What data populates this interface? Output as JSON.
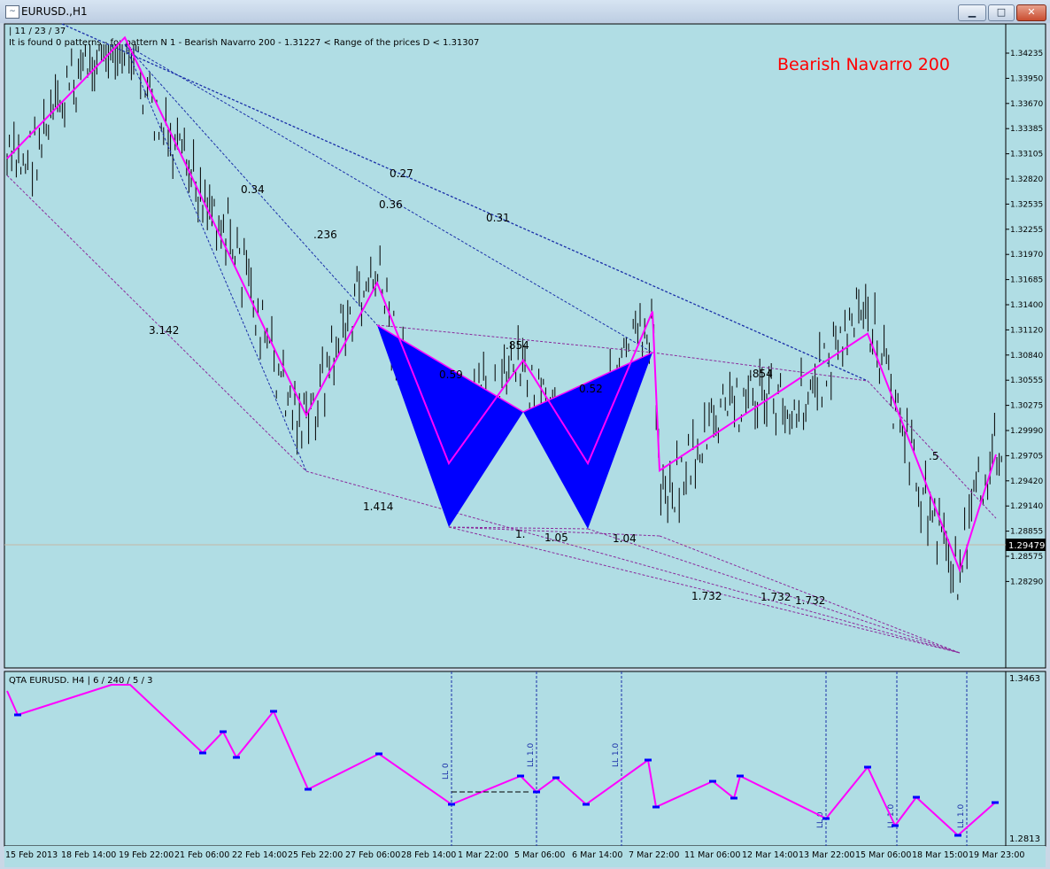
{
  "window": {
    "title": "EURUSD.,H1",
    "buttons": {
      "minimize": "▁",
      "maximize": "□",
      "close": "✕"
    }
  },
  "main_chart": {
    "info_line1": "| 11 / 23 / 37",
    "info_line2": "It is found 0 patterns  -  for pattern N 1 - Bearish Navarro 200   - 1.31227 < Range of the prices D < 1.31307",
    "pattern_title": "Bearish Navarro 200",
    "current_price": "1.29479",
    "price_labels": [
      "1.34235",
      "1.33950",
      "1.33670",
      "1.33385",
      "1.33105",
      "1.32820",
      "1.32535",
      "1.32255",
      "1.31970",
      "1.31685",
      "1.31400",
      "1.31120",
      "1.30840",
      "1.30555",
      "1.30275",
      "1.29990",
      "1.29705",
      "1.29420",
      "1.29140",
      "1.28855",
      "1.28575",
      "1.28290"
    ],
    "ratio_labels": [
      "0.34",
      "0.27",
      "0.36",
      "0.31",
      ".236",
      "3.142",
      ".854",
      ".854",
      "0.59",
      "0.52",
      "1.414",
      "1.",
      "1.05",
      "1.04",
      "1.732",
      "1.732",
      "1.732",
      ".5"
    ]
  },
  "indicator": {
    "title": "QTA EURUSD. H4 | 6 / 240 / 5 / 3",
    "price_top": "1.3463",
    "price_bottom": "1.2813",
    "marker_label": "LL 0",
    "marker_label_alt": "LL 1.0"
  },
  "time_axis": [
    "15 Feb 2013",
    "18 Feb 14:00",
    "19 Feb 22:00",
    "21 Feb 06:00",
    "22 Feb 14:00",
    "25 Feb 22:00",
    "27 Feb 06:00",
    "28 Feb 14:00",
    "1 Mar 22:00",
    "5 Mar 06:00",
    "6 Mar 14:00",
    "7 Mar 22:00",
    "11 Mar 06:00",
    "12 Mar 14:00",
    "13 Mar 22:00",
    "15 Mar 06:00",
    "18 Mar 15:00",
    "19 Mar 23:00"
  ],
  "colors": {
    "chart_bg": "#b0dde4",
    "zigzag": "#ff00ff",
    "fill": "#0000ff",
    "title_red": "#ff0000",
    "dotted_blue": "#1a2fa8",
    "dotted_purple": "#8a2b9c"
  },
  "chart_data": {
    "type": "line",
    "title": "Bearish Navarro 200",
    "instrument": "EURUSD.",
    "timeframe": "H1",
    "ylim": [
      1.2829,
      1.3452
    ],
    "zigzag_points": [
      {
        "time": "15 Feb 2013",
        "price": 1.3305
      },
      {
        "time": "19 Feb 22:00",
        "price": 1.3441
      },
      {
        "time": "25 Feb 22:00",
        "price": 1.3016
      },
      {
        "time": "27 Feb 06:00",
        "price": 1.3165
      },
      {
        "time": "28 Feb 14:00",
        "price": 1.2962
      },
      {
        "time": "5 Mar 06:00",
        "price": 1.3078
      },
      {
        "time": "6 Mar 14:00",
        "price": 1.2962
      },
      {
        "time": "7 Mar 22:00",
        "price": 1.3133
      },
      {
        "time": "7 Mar 22:00",
        "price": 1.2954
      },
      {
        "time": "15 Mar 06:00",
        "price": 1.3108
      },
      {
        "time": "19 Mar 15:00",
        "price": 1.2842
      },
      {
        "time": "19 Mar 23:00",
        "price": 1.2972
      }
    ],
    "indicator_series": {
      "name": "QTA EURUSD. H4",
      "ylim": [
        1.2813,
        1.3463
      ]
    }
  }
}
